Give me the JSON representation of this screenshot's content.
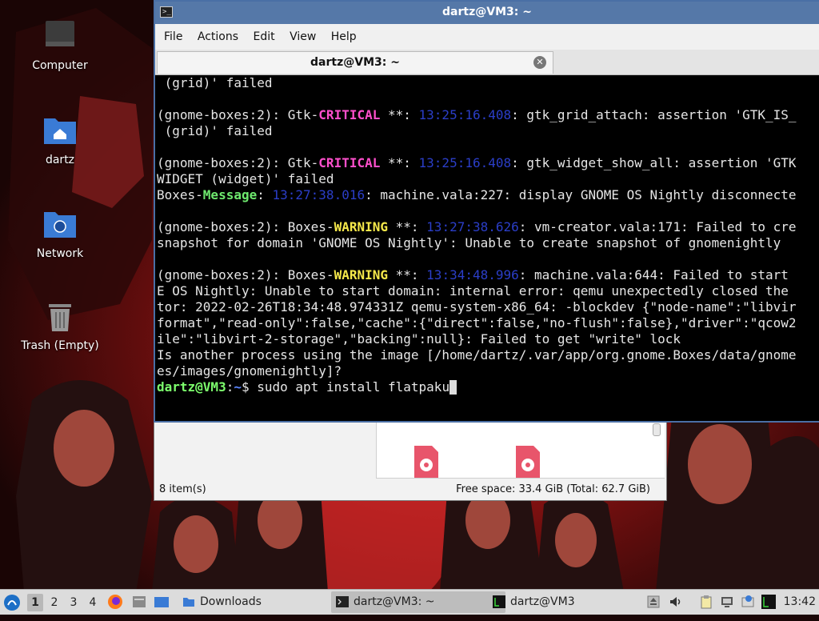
{
  "desktop": {
    "icons": [
      {
        "label": "Computer",
        "icon": "computer-icon"
      },
      {
        "label": "dartz",
        "icon": "home-folder-icon"
      },
      {
        "label": "Network",
        "icon": "network-folder-icon"
      },
      {
        "label": "Trash (Empty)",
        "icon": "trash-icon"
      }
    ]
  },
  "terminal": {
    "title": "dartz@VM3: ~",
    "menu": [
      "File",
      "Actions",
      "Edit",
      "View",
      "Help"
    ],
    "tab_label": "dartz@VM3: ~",
    "lines": [
      [
        {
          "t": " (grid)' failed"
        }
      ],
      [
        {
          "t": ""
        }
      ],
      [
        {
          "t": "(gnome-boxes:2): Gtk-"
        },
        {
          "t": "CRITICAL",
          "c": "crit"
        },
        {
          "t": " **: "
        },
        {
          "t": "13:25:16.408",
          "c": "time"
        },
        {
          "t": ": gtk_grid_attach: assertion 'GTK_IS_"
        }
      ],
      [
        {
          "t": " (grid)' failed"
        }
      ],
      [
        {
          "t": ""
        }
      ],
      [
        {
          "t": "(gnome-boxes:2): Gtk-"
        },
        {
          "t": "CRITICAL",
          "c": "crit"
        },
        {
          "t": " **: "
        },
        {
          "t": "13:25:16.408",
          "c": "time"
        },
        {
          "t": ": gtk_widget_show_all: assertion 'GTK"
        }
      ],
      [
        {
          "t": "WIDGET (widget)' failed"
        }
      ],
      [
        {
          "t": "Boxes-"
        },
        {
          "t": "Message",
          "c": "msg"
        },
        {
          "t": ": "
        },
        {
          "t": "13:27:38.016",
          "c": "time"
        },
        {
          "t": ": machine.vala:227: display GNOME OS Nightly disconnecte"
        }
      ],
      [
        {
          "t": ""
        }
      ],
      [
        {
          "t": "(gnome-boxes:2): Boxes-"
        },
        {
          "t": "WARNING",
          "c": "warn"
        },
        {
          "t": " **: "
        },
        {
          "t": "13:27:38.626",
          "c": "time"
        },
        {
          "t": ": vm-creator.vala:171: Failed to cre"
        }
      ],
      [
        {
          "t": "snapshot for domain 'GNOME OS Nightly': Unable to create snapshot of gnomenightly"
        }
      ],
      [
        {
          "t": ""
        }
      ],
      [
        {
          "t": "(gnome-boxes:2): Boxes-"
        },
        {
          "t": "WARNING",
          "c": "warn"
        },
        {
          "t": " **: "
        },
        {
          "t": "13:34:48.996",
          "c": "time"
        },
        {
          "t": ": machine.vala:644: Failed to start"
        }
      ],
      [
        {
          "t": "E OS Nightly: Unable to start domain: internal error: qemu unexpectedly closed the"
        }
      ],
      [
        {
          "t": "tor: 2022-02-26T18:34:48.974331Z qemu-system-x86_64: -blockdev {\"node-name\":\"libvir"
        }
      ],
      [
        {
          "t": "format\",\"read-only\":false,\"cache\":{\"direct\":false,\"no-flush\":false},\"driver\":\"qcow2"
        }
      ],
      [
        {
          "t": "ile\":\"libvirt-2-storage\",\"backing\":null}: Failed to get \"write\" lock"
        }
      ],
      [
        {
          "t": "Is another process using the image [/home/dartz/.var/app/org.gnome.Boxes/data/gnome"
        }
      ],
      [
        {
          "t": "es/images/gnomenightly]?"
        }
      ]
    ],
    "prompt_user": "dartz@VM3",
    "prompt_sep": ":",
    "prompt_path": "~",
    "prompt_symbol": "$ ",
    "command": "sudo apt install flatpaku"
  },
  "file_manager": {
    "status_items": "8 item(s)",
    "free_space": "Free space: 33.4 GiB (Total: 62.7 GiB)",
    "files": [
      {
        "icon": "audio-file-icon"
      },
      {
        "icon": "audio-file-icon"
      }
    ]
  },
  "taskbar": {
    "workspaces": [
      "1",
      "2",
      "3",
      "4"
    ],
    "active_workspace": "1",
    "tasks": [
      {
        "label": "Downloads",
        "icon": "folder-icon"
      },
      {
        "label": "dartz@VM3: ~",
        "icon": "terminal-icon",
        "active": true
      },
      {
        "label": "dartz@VM3",
        "icon": "terminal-icon"
      }
    ],
    "clock": "13:42"
  },
  "colors": {
    "titlebar": "#5578a8",
    "critical": "#ff4fcc",
    "warning": "#f5e84a",
    "message": "#6ee86e",
    "timestamp": "#2b3ec8",
    "prompt_user": "#7dff6d",
    "prompt_path": "#5b86ff"
  }
}
